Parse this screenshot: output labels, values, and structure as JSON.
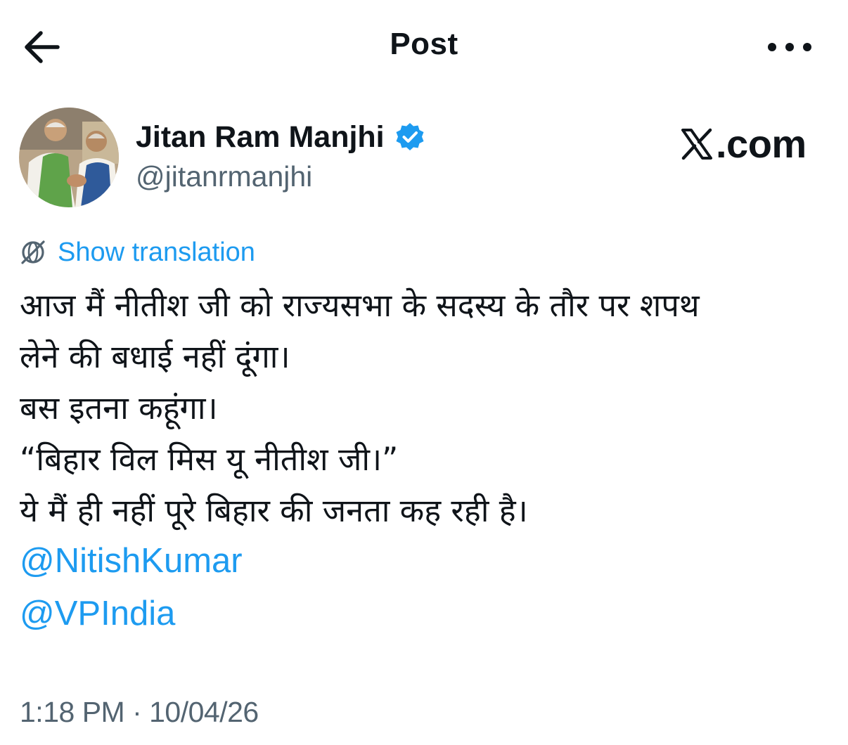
{
  "header": {
    "title": "Post",
    "back_icon": "arrow-left-icon",
    "more_icon": "more-horizontal-icon"
  },
  "author": {
    "name": "Jitan Ram Manjhi",
    "handle": "@jitanrmanjhi",
    "verified": true,
    "avatar": "profile-photo"
  },
  "brand": {
    "label": ".com",
    "icon": "x-logo-icon"
  },
  "translation": {
    "label": "Show translation",
    "icon": "globe-translate-icon"
  },
  "post": {
    "lines": [
      "आज मैं नीतीश जी को राज्यसभा के सदस्य के तौर पर शपथ",
      "लेने की बधाई नहीं दूंगा।",
      "बस इतना कहूंगा।",
      "“बिहार विल मिस यू नीतीश जी।”",
      "ये मैं ही नहीं पूरे बिहार की जनता कह रही है।"
    ],
    "mentions": [
      "@NitishKumar",
      "@VPIndia"
    ]
  },
  "timestamp": "1:18 PM · 10/04/26",
  "colors": {
    "accent": "#1d9bf0",
    "text": "#0f1419",
    "secondary": "#536471",
    "background": "#ffffff"
  }
}
